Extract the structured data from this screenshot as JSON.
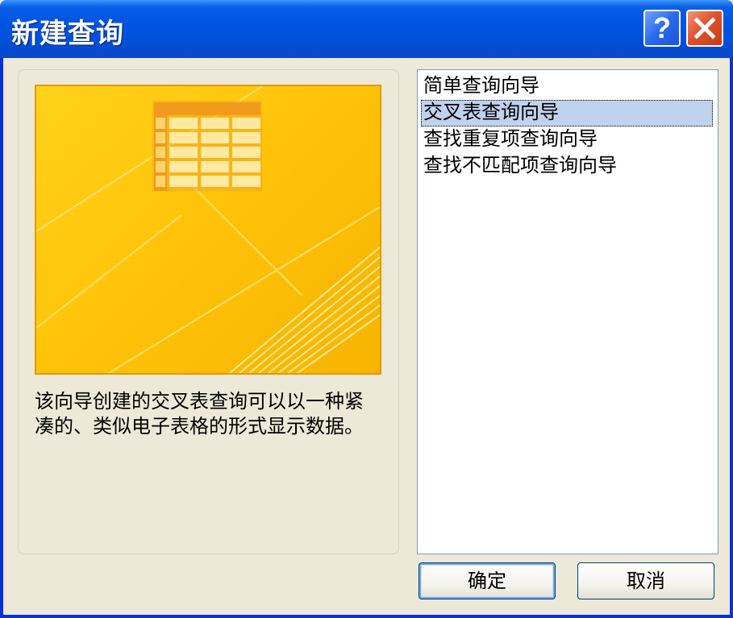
{
  "window": {
    "title": "新建查询",
    "help_label": "?"
  },
  "preview": {
    "description": "该向导创建的交叉表查询可以以一种紧凑的、类似电子表格的形式显示数据。",
    "colors": {
      "background": "#ffc40a",
      "border": "#e69800",
      "grid_header": "#f5a623",
      "grid_cell": "#fde9a0"
    }
  },
  "wizard_list": {
    "items": [
      {
        "label": "简单查询向导",
        "selected": false
      },
      {
        "label": "交叉表查询向导",
        "selected": true
      },
      {
        "label": "查找重复项查询向导",
        "selected": false
      },
      {
        "label": "查找不匹配项查询向导",
        "selected": false
      }
    ]
  },
  "buttons": {
    "ok_label": "确定",
    "cancel_label": "取消"
  }
}
